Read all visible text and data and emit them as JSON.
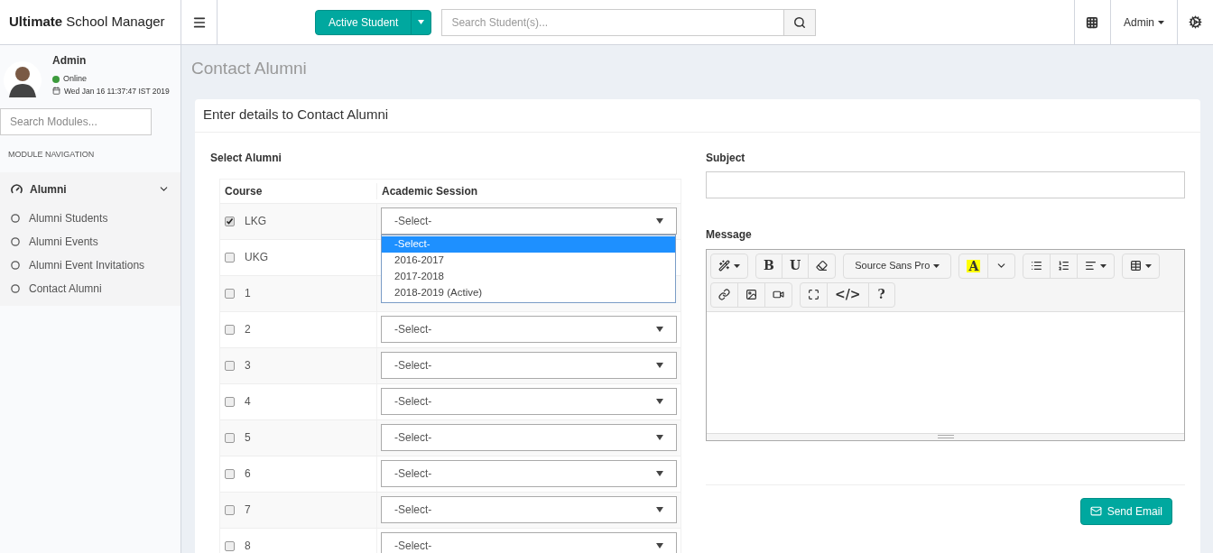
{
  "header": {
    "brand": "**Ultimate** School Manager",
    "student_button": "Active Student",
    "search": {
      "placeholder": "Search Student(s)..."
    },
    "user_menu": "Admin"
  },
  "sidebar": {
    "user": {
      "name": "Admin",
      "status": "Online",
      "color": "#3c9a3c",
      "date": "Wed Jan 16 11:37:47 IST 2019"
    },
    "search": {
      "placeholder": "Search Modules..."
    },
    "section_label": "MODULE NAVIGATION",
    "menu": {
      "label": "Alumni",
      "expanded": true,
      "children": [
        {
          "label": "Alumni Students",
          "selected": false
        },
        {
          "label": "Alumni Events",
          "selected": false
        },
        {
          "label": "Alumni Event Invitations",
          "selected": false
        },
        {
          "label": "Contact Alumni",
          "selected": false
        }
      ]
    }
  },
  "page_title": "Contact Alumni",
  "card": {
    "title": "Enter details to Contact Alumni",
    "select_label": "Select Alumni",
    "table": {
      "columns": [
        "Course",
        "Academic Session"
      ],
      "rows": [
        {
          "course": "LKG",
          "checked": true,
          "session": "-Select-"
        },
        {
          "course": "UKG",
          "checked": false
        },
        {
          "course": "1",
          "checked": false
        },
        {
          "course": "2",
          "checked": false,
          "session": "-Select-"
        },
        {
          "course": "3",
          "checked": false,
          "session": "-Select-"
        },
        {
          "course": "4",
          "checked": false,
          "session": "-Select-"
        },
        {
          "course": "5",
          "checked": false,
          "session": "-Select-"
        },
        {
          "course": "6",
          "checked": false,
          "session": "-Select-"
        },
        {
          "course": "7",
          "checked": false,
          "session": "-Select-"
        },
        {
          "course": "8",
          "checked": false,
          "session": "-Select-"
        }
      ]
    },
    "dropdown": {
      "options": [
        {
          "label": "-Select-",
          "selected": true
        },
        {
          "label": "2016-2017",
          "selected": false
        },
        {
          "label": "2017-2018",
          "selected": false
        },
        {
          "label": "2018-2019 (Active)",
          "selected": false
        }
      ]
    },
    "subject_label": "Subject",
    "message_label": "Message",
    "editor_toolbar": [
      [
        [
          {
            "kind": "icon",
            "caret": true
          }
        ],
        [
          {
            "kind": "text",
            "label": "B"
          },
          {
            "kind": "text",
            "label": "U"
          },
          {
            "kind": "icon"
          }
        ],
        [
          {
            "kind": "font",
            "label": "Source Sans Pro"
          }
        ],
        [
          {
            "kind": "highlight",
            "label": "A"
          },
          {
            "kind": "icon"
          }
        ],
        [
          {
            "kind": "icon"
          },
          {
            "kind": "icon"
          },
          {
            "kind": "icon",
            "caret": true
          }
        ],
        [
          {
            "kind": "icon",
            "caret": true
          }
        ]
      ],
      [
        [
          {
            "kind": "icon"
          },
          {
            "kind": "icon"
          },
          {
            "kind": "icon"
          }
        ],
        [
          {
            "kind": "icon"
          },
          {
            "kind": "text",
            "label": "</>"
          },
          {
            "kind": "text",
            "label": "?"
          }
        ]
      ]
    ],
    "send_button": "Send Email"
  }
}
